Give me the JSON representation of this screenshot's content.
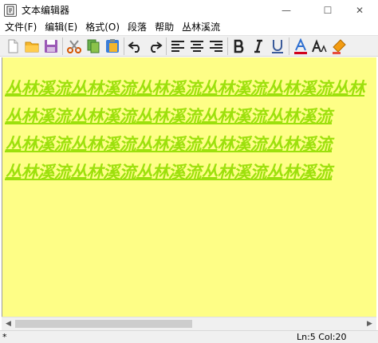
{
  "window": {
    "title": "文本编辑器",
    "controls": {
      "minimize": "—",
      "maximize": "☐",
      "close": "✕"
    }
  },
  "menu": {
    "items": [
      "文件(F)",
      "编辑(E)",
      "格式(O)",
      "段落",
      "帮助",
      "丛林溪流"
    ]
  },
  "toolbar": {
    "buttons": [
      "new-file-icon",
      "open-folder-icon",
      "save-icon",
      "cut-icon",
      "copy-icon",
      "paste-icon",
      "undo-icon",
      "redo-icon",
      "align-left-icon",
      "align-center-icon",
      "align-right-icon",
      "bold-icon",
      "italic-icon",
      "underline-icon",
      "font-color-icon",
      "font-size-icon",
      "background-color-icon"
    ]
  },
  "editor": {
    "background": "#fefe86",
    "text_color": "#9de00c",
    "lines": [
      "丛林溪流丛林溪流丛林溪流丛林溪流丛林溪流丛林",
      "丛林溪流丛林溪流丛林溪流丛林溪流丛林溪流",
      "丛林溪流丛林溪流丛林溪流丛林溪流丛林溪流",
      "丛林溪流丛林溪流丛林溪流丛林溪流丛林溪流"
    ]
  },
  "status": {
    "left": "*",
    "position": "Ln:5 Col:20"
  }
}
